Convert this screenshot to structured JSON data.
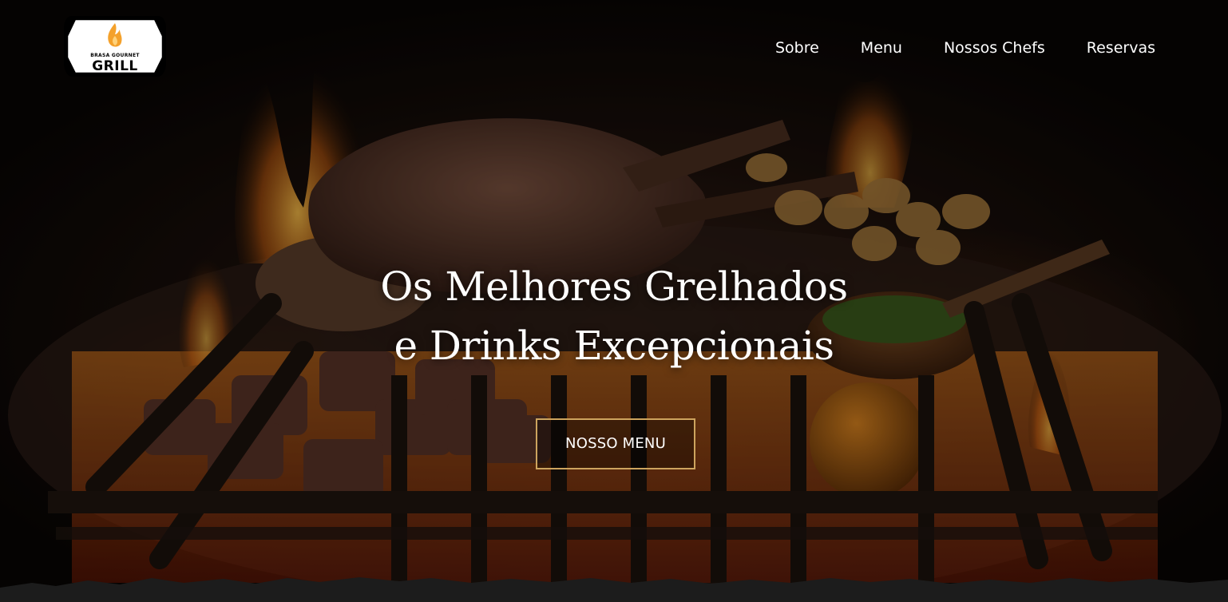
{
  "brand": {
    "logo_small_text": "BRASA GOURNET",
    "logo_big_text": "GRILL",
    "accent_color": "#cda45e",
    "flame_color": "#f4a12b"
  },
  "nav": {
    "items": [
      {
        "label": "Sobre"
      },
      {
        "label": "Menu"
      },
      {
        "label": "Nossos Chefs"
      },
      {
        "label": "Reservas"
      }
    ]
  },
  "hero": {
    "title_line1": "Os Melhores Grelhados",
    "title_line2": "e Drinks Excepcionais",
    "cta_label": "NOSSO MENU",
    "background_description_icon": "grill-flames-photo"
  }
}
